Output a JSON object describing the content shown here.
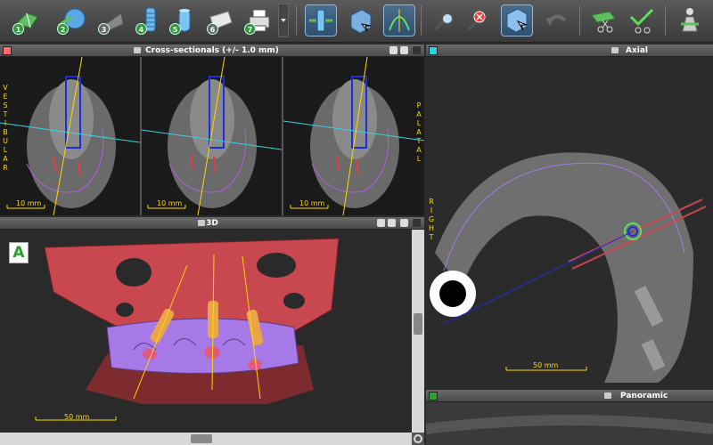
{
  "toolbar": {
    "buttons": [
      {
        "name": "step-1-button",
        "num": "1",
        "icon": "arrow-plan-icon"
      },
      {
        "name": "step-2-button",
        "num": "2",
        "icon": "sphere-icon"
      },
      {
        "name": "step-3-button",
        "num": "3",
        "icon": "flat-shape-icon"
      },
      {
        "name": "step-4-button",
        "num": "4",
        "icon": "implant-icon"
      },
      {
        "name": "step-5-button",
        "num": "5",
        "icon": "cylinder-icon"
      },
      {
        "name": "step-6-button",
        "num": "6",
        "icon": "folder-icon"
      },
      {
        "name": "step-7-button",
        "num": "7",
        "icon": "printer-icon"
      }
    ]
  },
  "panels": {
    "cross": {
      "title": "Cross-sectionals (+/- 1.0 mm)",
      "color": "#ff6b6b"
    },
    "axial": {
      "title": "Axial",
      "color": "#28d4e0"
    },
    "three_d": {
      "title": "3D"
    },
    "panoramic": {
      "title": "Panoramic",
      "color": "#2aa02a"
    }
  },
  "labels": {
    "vestibular": "VESTIBULAR",
    "palatal": "PALATAL",
    "right": "RIGHT",
    "anterior_badge": "A"
  },
  "scales": {
    "cross": "10 mm",
    "three_d": "50 mm",
    "axial": "50 mm"
  }
}
